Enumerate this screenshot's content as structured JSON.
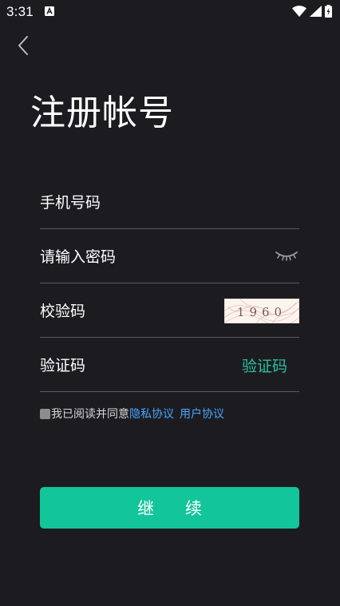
{
  "status_bar": {
    "time": "3:31",
    "notification_icon": "text-recognition-icon",
    "icons": [
      "wifi-icon",
      "signal-icon",
      "battery-charging-icon"
    ]
  },
  "nav": {
    "back_icon": "chevron-left-icon"
  },
  "title": "注册帐号",
  "form": {
    "phone_placeholder": "手机号码",
    "password_placeholder": "请输入密码",
    "password_toggle_icon": "eye-closed-icon",
    "captcha_placeholder": "校验码",
    "captcha_image_text": "1960",
    "sms_code_placeholder": "验证码",
    "sms_code_button": "验证码"
  },
  "agreement": {
    "text": "我已阅读并同意",
    "privacy_link": "隐私协议",
    "user_link": "用户协议",
    "checked": false
  },
  "continue_label": "继 续",
  "colors": {
    "background": "#1c1c20",
    "accent": "#13c59a",
    "link": "#4aa3ff",
    "divider": "#5b5b60"
  }
}
